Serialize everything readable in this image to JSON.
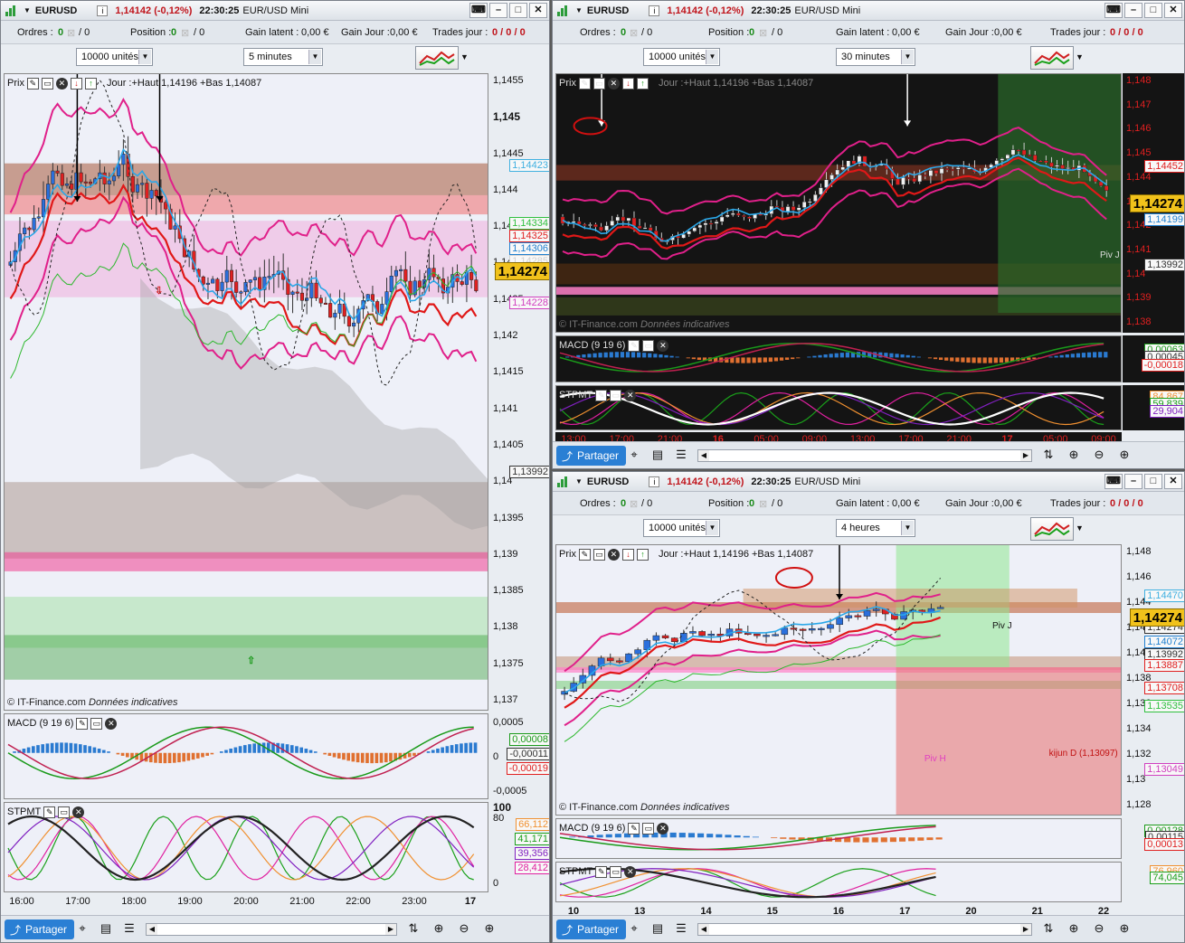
{
  "windows": [
    {
      "symbol": "EURUSD",
      "change": "1,14142 (-0,12%)",
      "time": "22:30:25",
      "instrument": "EUR/USD Mini",
      "orders_label": "Ordres :",
      "orders_value": "0",
      "orders_slash": "/ 0",
      "position_label": "Position :",
      "position_value": "0",
      "position_slash": "/ 0",
      "latent_label": "Gain latent :",
      "latent_value": "0,00 €",
      "gainjour_label": "Gain Jour :",
      "gainjour_value": "0,00 €",
      "trades_label": "Trades jour :",
      "trades_value": "0 / 0 / 0",
      "units": "10000 unités",
      "timeframe": "5 minutes",
      "price_panel_label": "Prix",
      "day_info": "Jour :+Haut 1,14196 +Bas 1,14087",
      "watermark_brand": "© IT-Finance.com",
      "watermark_text": "Données indicatives",
      "macd_label": "MACD (9 19 6)",
      "stpmt_label": "STPMT",
      "share_label": "Partager",
      "price_ticks": [
        "1,1455",
        "1,145",
        "1,1445",
        "1,144",
        "1,1435",
        "1,143",
        "1,1425",
        "1,142",
        "1,1415",
        "1,141",
        "1,1405",
        "1,14",
        "1,1395",
        "1,139",
        "1,1385",
        "1,138",
        "1,1375",
        "1,137"
      ],
      "price_boxes": [
        "1,14423",
        "1,14334",
        "1,14325",
        "1,14306",
        "1,14285",
        "1,14228",
        "1,13992"
      ],
      "last_price": "1,14274",
      "macd_ticks": [
        "0,0005",
        "0",
        "-0,0005"
      ],
      "macd_boxes": [
        "0,00008",
        "-0,00011",
        "-0,00019"
      ],
      "stpmt_ticks": [
        "100",
        "80",
        "0"
      ],
      "stpmt_boxes": [
        "66,112",
        "41,171",
        "39,356",
        "28,412"
      ],
      "x_labels": [
        "16:00",
        "17:00",
        "18:00",
        "19:00",
        "20:00",
        "21:00",
        "22:00",
        "23:00",
        "17"
      ]
    },
    {
      "symbol": "EURUSD",
      "change": "1,14142 (-0,12%)",
      "time": "22:30:25",
      "instrument": "EUR/USD Mini",
      "orders_label": "Ordres :",
      "orders_value": "0",
      "orders_slash": "/ 0",
      "position_label": "Position :",
      "position_value": "0",
      "position_slash": "/ 0",
      "latent_label": "Gain latent :",
      "latent_value": "0,00 €",
      "gainjour_label": "Gain Jour :",
      "gainjour_value": "0,00 €",
      "trades_label": "Trades jour :",
      "trades_value": "0 / 0 / 0",
      "units": "10000 unités",
      "timeframe": "30 minutes",
      "price_panel_label": "Prix",
      "day_info": "Jour :+Haut 1,14196 +Bas 1,14087",
      "watermark_brand": "© IT-Finance.com",
      "watermark_text": "Données indicatives",
      "macd_label": "MACD (9 19 6)",
      "stpmt_label": "STPMT",
      "share_label": "Partager",
      "piv_label": "Piv J",
      "price_ticks": [
        "1,148",
        "1,147",
        "1,146",
        "1,145",
        "1,144",
        "1,143",
        "1,142",
        "1,141",
        "1,14",
        "1,139",
        "1,138"
      ],
      "price_boxes": [
        "1,14452",
        "1,14199",
        "1,13992"
      ],
      "last_price": "1,14274",
      "macd_boxes": [
        "0,00063",
        "0,00045",
        "-0,00018"
      ],
      "stpmt_boxes": [
        "84,867",
        "59,839",
        "29,904"
      ],
      "x_labels": [
        "13:00",
        "17:00",
        "21:00",
        "16",
        "05:00",
        "09:00",
        "13:00",
        "17:00",
        "21:00",
        "17",
        "05:00",
        "09:00"
      ]
    },
    {
      "symbol": "EURUSD",
      "change": "1,14142 (-0,12%)",
      "time": "22:30:25",
      "instrument": "EUR/USD Mini",
      "orders_label": "Ordres :",
      "orders_value": "0",
      "orders_slash": "/ 0",
      "position_label": "Position :",
      "position_value": "0",
      "position_slash": "/ 0",
      "latent_label": "Gain latent :",
      "latent_value": "0,00 €",
      "gainjour_label": "Gain Jour :",
      "gainjour_value": "0,00 €",
      "trades_label": "Trades jour :",
      "trades_value": "0 / 0 / 0",
      "units": "10000 unités",
      "timeframe": "4 heures",
      "price_panel_label": "Prix",
      "day_info": "Jour :+Haut 1,14196 +Bas 1,14087",
      "watermark_brand": "© IT-Finance.com",
      "watermark_text": "Données indicatives",
      "macd_label": "MACD (9 19 6)",
      "stpmt_label": "STPMT",
      "share_label": "Partager",
      "piv_label": "Piv J",
      "pivh_label": "Piv H",
      "kijun_label": "kijun D (1,13097)",
      "price_ticks": [
        "1,148",
        "1,146",
        "1,144",
        "1,142",
        "1,14",
        "1,138",
        "1,136",
        "1,134",
        "1,132",
        "1,13",
        "1,128"
      ],
      "price_boxes": [
        "1,14470",
        "1,14274",
        "1,14072",
        "1,13992",
        "1,13887",
        "1,13708",
        "1,13535",
        "1,13049"
      ],
      "last_price": "1,14274",
      "macd_boxes": [
        "0,00128",
        "0,00115",
        "0,00013"
      ],
      "stpmt_boxes": [
        "76,960",
        "74,045"
      ],
      "x_labels": [
        "10",
        "13",
        "14",
        "15",
        "16",
        "17",
        "20",
        "21",
        "22"
      ]
    }
  ],
  "colors": {
    "bull": "#2a6fdc",
    "bear": "#e02020",
    "bollinger": "#e0208a",
    "kijun": "#e01818",
    "tenkan": "#2aa7e8",
    "senkou": "#2cb82c",
    "last_price_bg": "#f1c21b"
  },
  "icons": [
    "logo-icon",
    "info-icon",
    "minimize-icon",
    "maximize-icon",
    "close-icon",
    "wrench-icon",
    "window-icon",
    "indicators-icon",
    "share-icon",
    "crosshair-icon",
    "zoom-in-icon",
    "zoom-out-icon"
  ]
}
